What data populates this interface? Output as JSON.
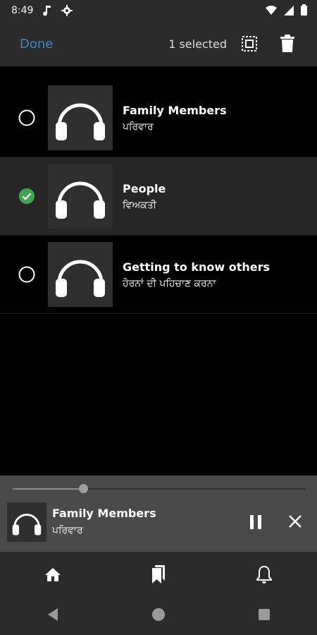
{
  "status_bar": {
    "time": "8:49"
  },
  "toolbar": {
    "done_label": "Done",
    "selected_text": "1 selected"
  },
  "items": [
    {
      "title": "Family Members",
      "subtitle": "ਪਰਿਵਾਰ",
      "selected": false
    },
    {
      "title": "People",
      "subtitle": "ਵਿਅਕਤੀ",
      "selected": true
    },
    {
      "title": "Getting to know others",
      "subtitle": "ਹੋਰਨਾਂ ਦੀ ਪਹਿਚਾਣ ਕਰਨਾ",
      "selected": false
    }
  ],
  "player": {
    "title": "Family Members",
    "subtitle": "ਪਰਿਵਾਰ",
    "progress": 0.24
  },
  "bottom_nav": [
    {
      "icon": "home-icon"
    },
    {
      "icon": "bookmarks-icon"
    },
    {
      "icon": "bell-icon"
    }
  ],
  "colors": {
    "accent": "#3b88c7",
    "check": "#3fa64f"
  }
}
